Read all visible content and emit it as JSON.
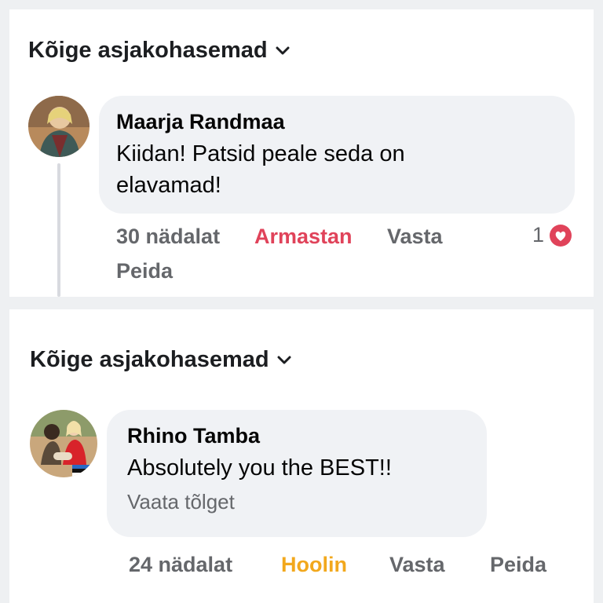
{
  "comments": [
    {
      "sort_label": "Kõige asjakohasemad",
      "author": "Maarja Randmaa",
      "text": "Kiidan! Patsid peale seda on elavamad!",
      "time": "30 nädalat",
      "reaction_label": "Armastan",
      "reaction_color": "#e0435a",
      "reply_label": "Vasta",
      "hide_label": "Peida",
      "reaction_count": "1",
      "reaction_icon": "heart-icon"
    },
    {
      "sort_label": "Kõige asjakohasemad",
      "author": "Rhino Tamba",
      "text": "Absolutely you the BEST!!",
      "translate_label": "Vaata tõlget",
      "time": "24 nädalat",
      "reaction_label": "Hoolin",
      "reaction_color": "#f2a81d",
      "reply_label": "Vasta",
      "hide_label": "Peida"
    }
  ],
  "colors": {
    "bubble": "#f0f2f5",
    "muted_text": "#65676b",
    "heart": "#e0435a"
  }
}
